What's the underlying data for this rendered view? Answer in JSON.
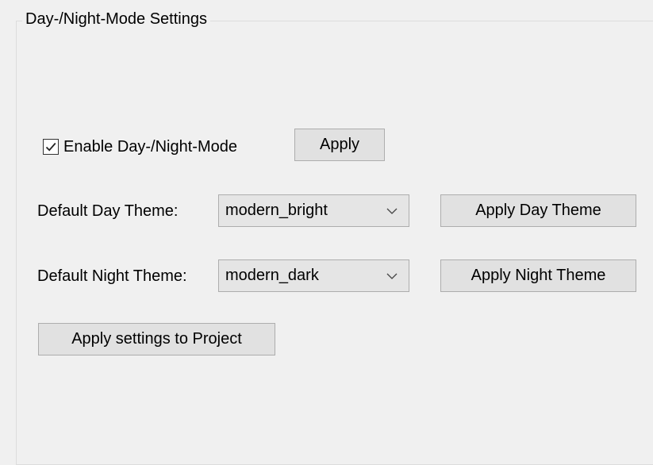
{
  "group": {
    "title": "Day-/Night-Mode Settings"
  },
  "enable": {
    "label": "Enable Day-/Night-Mode",
    "checked": true,
    "apply_label": "Apply"
  },
  "day_theme": {
    "label": "Default Day Theme:",
    "value": "modern_bright",
    "apply_label": "Apply Day Theme"
  },
  "night_theme": {
    "label": "Default Night Theme:",
    "value": "modern_dark",
    "apply_label": "Apply Night Theme"
  },
  "project": {
    "apply_label": "Apply settings to Project"
  },
  "icons": {
    "checkbox_mark": "check-icon",
    "combo_arrow": "chevron-down-icon"
  }
}
